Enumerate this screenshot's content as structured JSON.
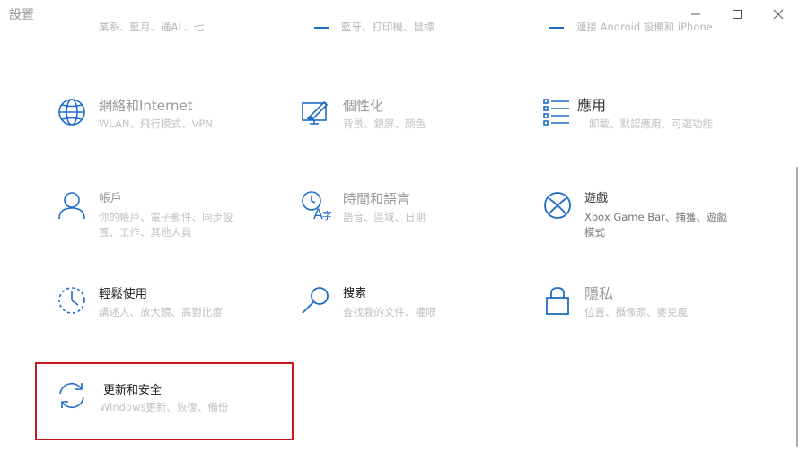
{
  "window": {
    "title": "設置"
  },
  "top_partial": [
    {
      "text": "藍牙、打印機、鼠標"
    },
    {
      "text": "連接 Android 設備和 iPhone"
    }
  ],
  "top_left_partial": "業系、藍月、通AL、七",
  "tiles": [
    {
      "name": "網絡和Internet",
      "desc": "WLAN、飛行模式、VPN",
      "icon": "globe-icon"
    },
    {
      "name": "個性化",
      "desc": "背景、鎖屏、顏色",
      "icon": "personalization-icon"
    },
    {
      "name": "應用",
      "desc": "卸載、默認應用、可選功能",
      "icon": "apps-list-icon"
    },
    {
      "name": "帳戶",
      "desc": "你的帳戶、電子郵件、同步設置、工作、其他人員",
      "icon": "person-icon"
    },
    {
      "name": "時間和語言",
      "desc": "語音、區域、日期",
      "icon": "time-language-icon"
    },
    {
      "name": "遊戲",
      "desc": "Xbox Game Bar、捕獲、遊戲模式",
      "icon": "xbox-icon"
    },
    {
      "name": "輕鬆使用",
      "desc": "講述人、放大鏡、高對比度",
      "icon": "ease-of-access-icon"
    },
    {
      "name": "搜索",
      "desc": "查找我的文件、權限",
      "icon": "search-icon"
    },
    {
      "name": "隱私",
      "desc": "位置、攝像頭、麥克風",
      "icon": "lock-icon"
    },
    {
      "name": "更新和安全",
      "desc": "Windows更新、恢復、備份",
      "icon": "sync-icon"
    }
  ],
  "colors": {
    "accent": "#1f6cc8",
    "highlight": "#c8161d"
  }
}
